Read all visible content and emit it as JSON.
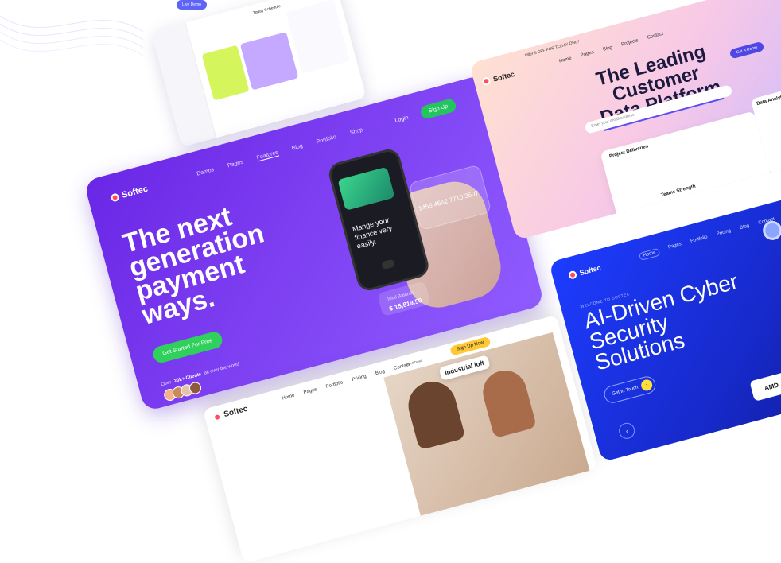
{
  "top_strip": {
    "cta": "Live Demo"
  },
  "dashboard": {
    "title": "Today Schedule"
  },
  "main": {
    "logo": "Softec",
    "nav": [
      "Demos",
      "Pages",
      "Features",
      "Blog",
      "Portfolio",
      "Shop"
    ],
    "login": "Login",
    "signup": "Sign Up",
    "hero_title": "The next generation payment ways.",
    "cta": "Get Started For Free",
    "clients_prefix": "Over",
    "clients_count": "20k+ Clients",
    "clients_suffix": "all over the world",
    "phone_text": "Mange your finance very easily.",
    "card_number": "1455 4562 7710 3507",
    "total_label": "Total Balance",
    "total_value": "$ 15,819.50"
  },
  "real_estate": {
    "logo": "Softec",
    "nav": [
      "Home",
      "Pages",
      "Portfolio",
      "Pricing",
      "Blog",
      "Contact"
    ],
    "signup": "Sign Up Now",
    "tag": "Industrial loft",
    "scroll": "Scroll Down"
  },
  "data_platform": {
    "offer": "Offer 5 OFF FOR TODAY ONLY",
    "logo": "Softec",
    "nav": [
      "Home",
      "Pages",
      "Blog",
      "Projects",
      "Contact"
    ],
    "headline_1": "The Leading Customer",
    "headline_2": "Data Platform",
    "demo": "Get A Demo",
    "search_placeholder": "Enter your email address",
    "panel_title": "Project Deliveries",
    "side_title": "Data Analytics",
    "team_title": "Teams Strength"
  },
  "cyber": {
    "logo": "Softec",
    "nav": [
      "Home",
      "Pages",
      "Portfolio",
      "Pricing",
      "Blog",
      "Contact"
    ],
    "welcome": "WELCOME TO SOFTEC",
    "headline": "AI-Driven Cyber Security Solutions",
    "cta": "Get In Touch",
    "partner_1": "AMD",
    "partner_2": "A"
  },
  "colors": {
    "purple": "#7b3cf0",
    "green": "#2fd05c",
    "blue": "#1d3cff",
    "yellow": "#ffde3a"
  }
}
